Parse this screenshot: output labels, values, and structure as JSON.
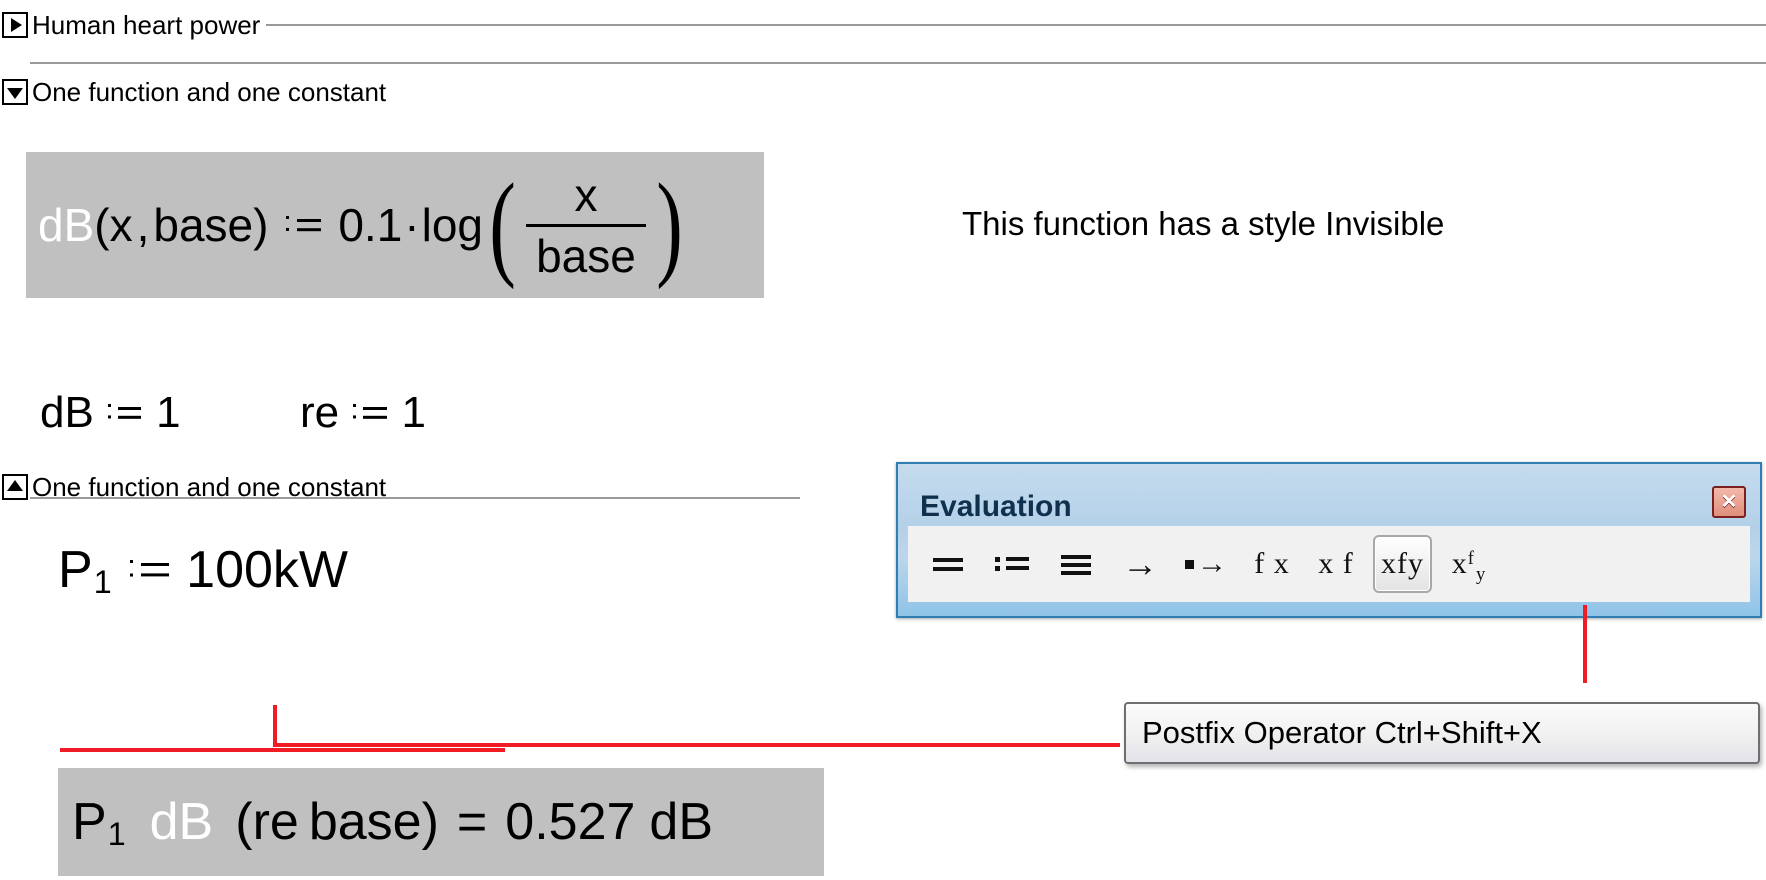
{
  "areas": [
    {
      "id": "human-heart-power",
      "title": "Human heart power",
      "toggle_icon": "triangle-right-icon",
      "state": "collapsed"
    },
    {
      "id": "one-function-and-one-constant-open",
      "title": "One function and one constant",
      "toggle_icon": "triangle-down-icon",
      "state": "expanded"
    },
    {
      "id": "one-function-and-one-constant-end",
      "title": "One function and one constant",
      "toggle_icon": "triangle-up-icon",
      "state": "area-end"
    }
  ],
  "regions": {
    "dB_definition": {
      "name": "dB",
      "args_open": "(",
      "arg1": "x",
      "comma": ",",
      "arg2": "base",
      "args_close": ")",
      "coefficient": "0.1",
      "dot": "·",
      "fn": "log",
      "numerator": "x",
      "denominator": "base"
    },
    "annotation": {
      "text": "This function has a style Invisible"
    },
    "constants": [
      {
        "name": "dB",
        "value": "1"
      },
      {
        "name": "re",
        "value": "1"
      }
    ],
    "power_definition": {
      "name": "P",
      "subscript": "1",
      "value": "100kW"
    },
    "result": {
      "name": "P",
      "subscript": "1",
      "unit_fn": "dB",
      "paren_open": "(",
      "re": "re",
      "base": "base",
      "paren_close": ")",
      "equals": "=",
      "value": "0.527",
      "unit": "dB"
    }
  },
  "palette": {
    "title": "Evaluation",
    "close_label": "✕",
    "buttons": [
      {
        "id": "evaluate",
        "label": "=",
        "glyph": "equals-glyph",
        "active": false
      },
      {
        "id": "definition",
        "label": ":=",
        "glyph": "definition-glyph",
        "active": false
      },
      {
        "id": "global-definition",
        "label": "≡",
        "glyph": "identical-glyph",
        "active": false
      },
      {
        "id": "symbolic-eval",
        "label": "→",
        "glyph": "arrow-glyph",
        "active": false
      },
      {
        "id": "symbolic-keyword",
        "label": "▪→",
        "glyph": "dot-arrow-glyph",
        "active": false
      },
      {
        "id": "prefix-operator",
        "label": "f x",
        "glyph": "prefix-glyph",
        "active": false
      },
      {
        "id": "postfix-operator-left",
        "label": "x f",
        "glyph": "postfix-glyph",
        "active": false
      },
      {
        "id": "infix-operator",
        "label": "xfy",
        "glyph": "infix-glyph",
        "active": true
      },
      {
        "id": "treefix-operator",
        "label": "x f y",
        "glyph": "treefix-glyph",
        "active": false
      }
    ]
  },
  "tooltip": {
    "text": "Postfix Operator Ctrl+Shift+X"
  }
}
